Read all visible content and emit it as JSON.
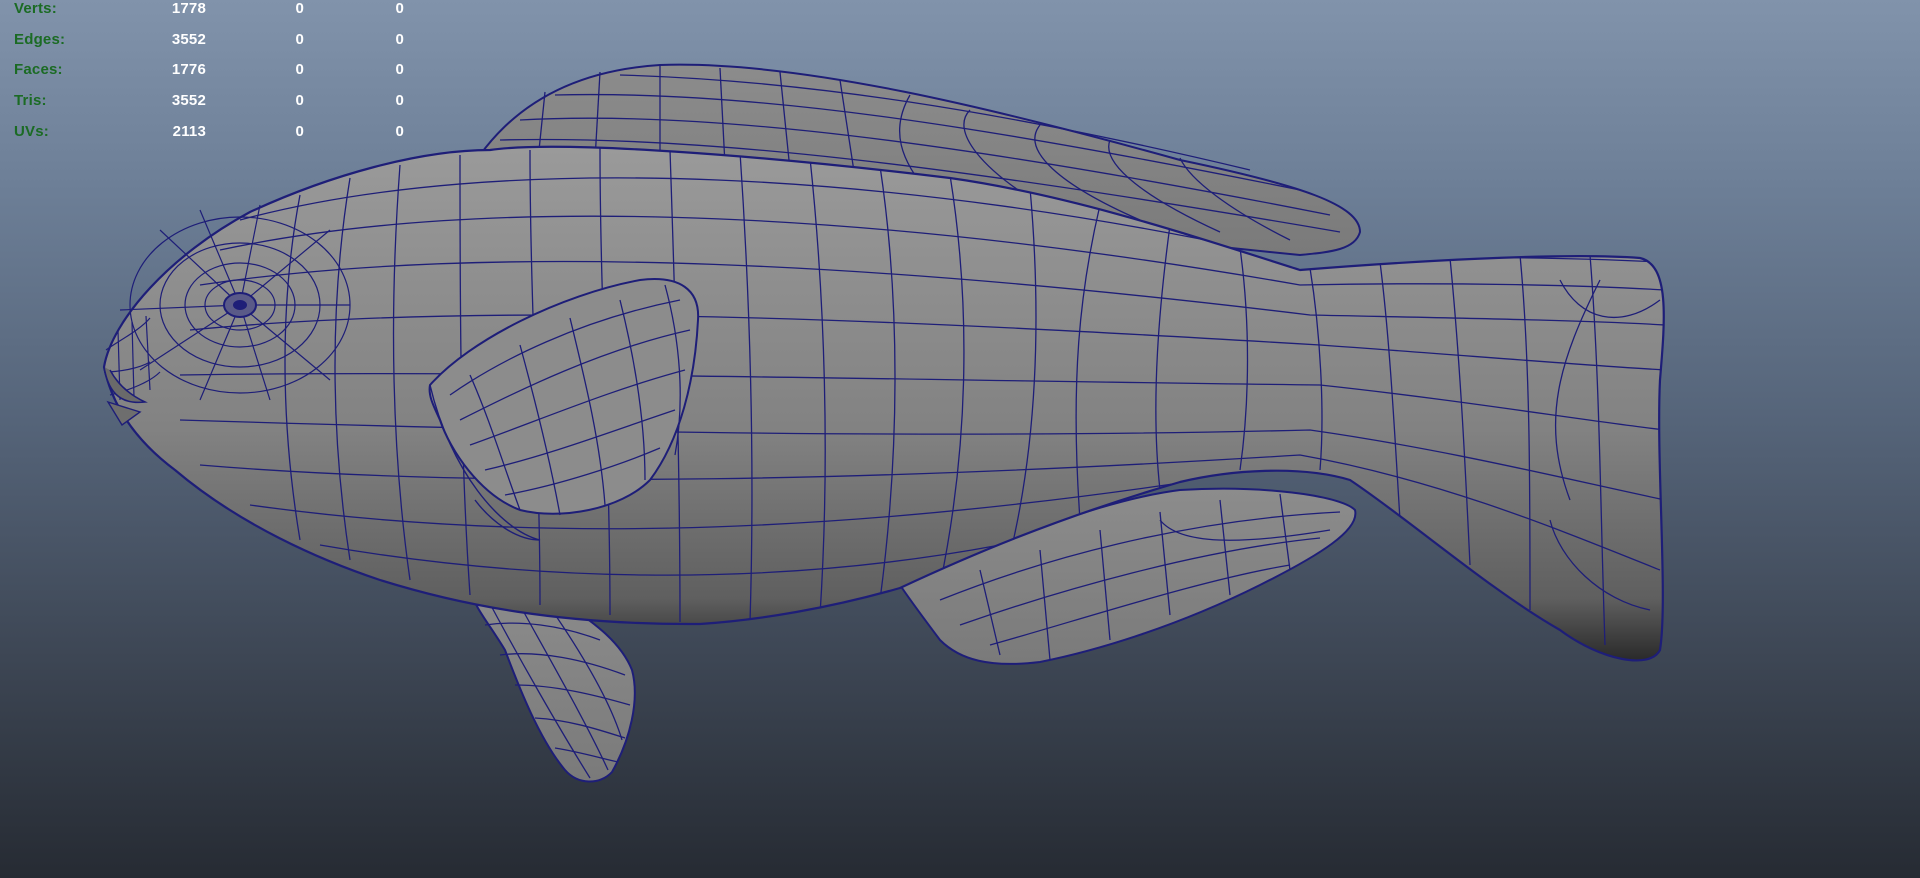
{
  "poly_count_hud": {
    "rows": [
      {
        "label": "Verts:",
        "total": "1778",
        "selected": "0",
        "component": "0"
      },
      {
        "label": "Edges:",
        "total": "3552",
        "selected": "0",
        "component": "0"
      },
      {
        "label": "Faces:",
        "total": "1776",
        "selected": "0",
        "component": "0"
      },
      {
        "label": "Tris:",
        "total": "3552",
        "selected": "0",
        "component": "0"
      },
      {
        "label": "UVs:",
        "total": "2113",
        "selected": "0",
        "component": "0"
      }
    ]
  },
  "colors": {
    "background_top": "#8193ab",
    "background_bottom": "#262b33",
    "hud_label": "#1b6b24",
    "hud_value": "#ffffff",
    "mesh_fill": "#7f7f7f",
    "wireframe": "#1e1e78"
  }
}
